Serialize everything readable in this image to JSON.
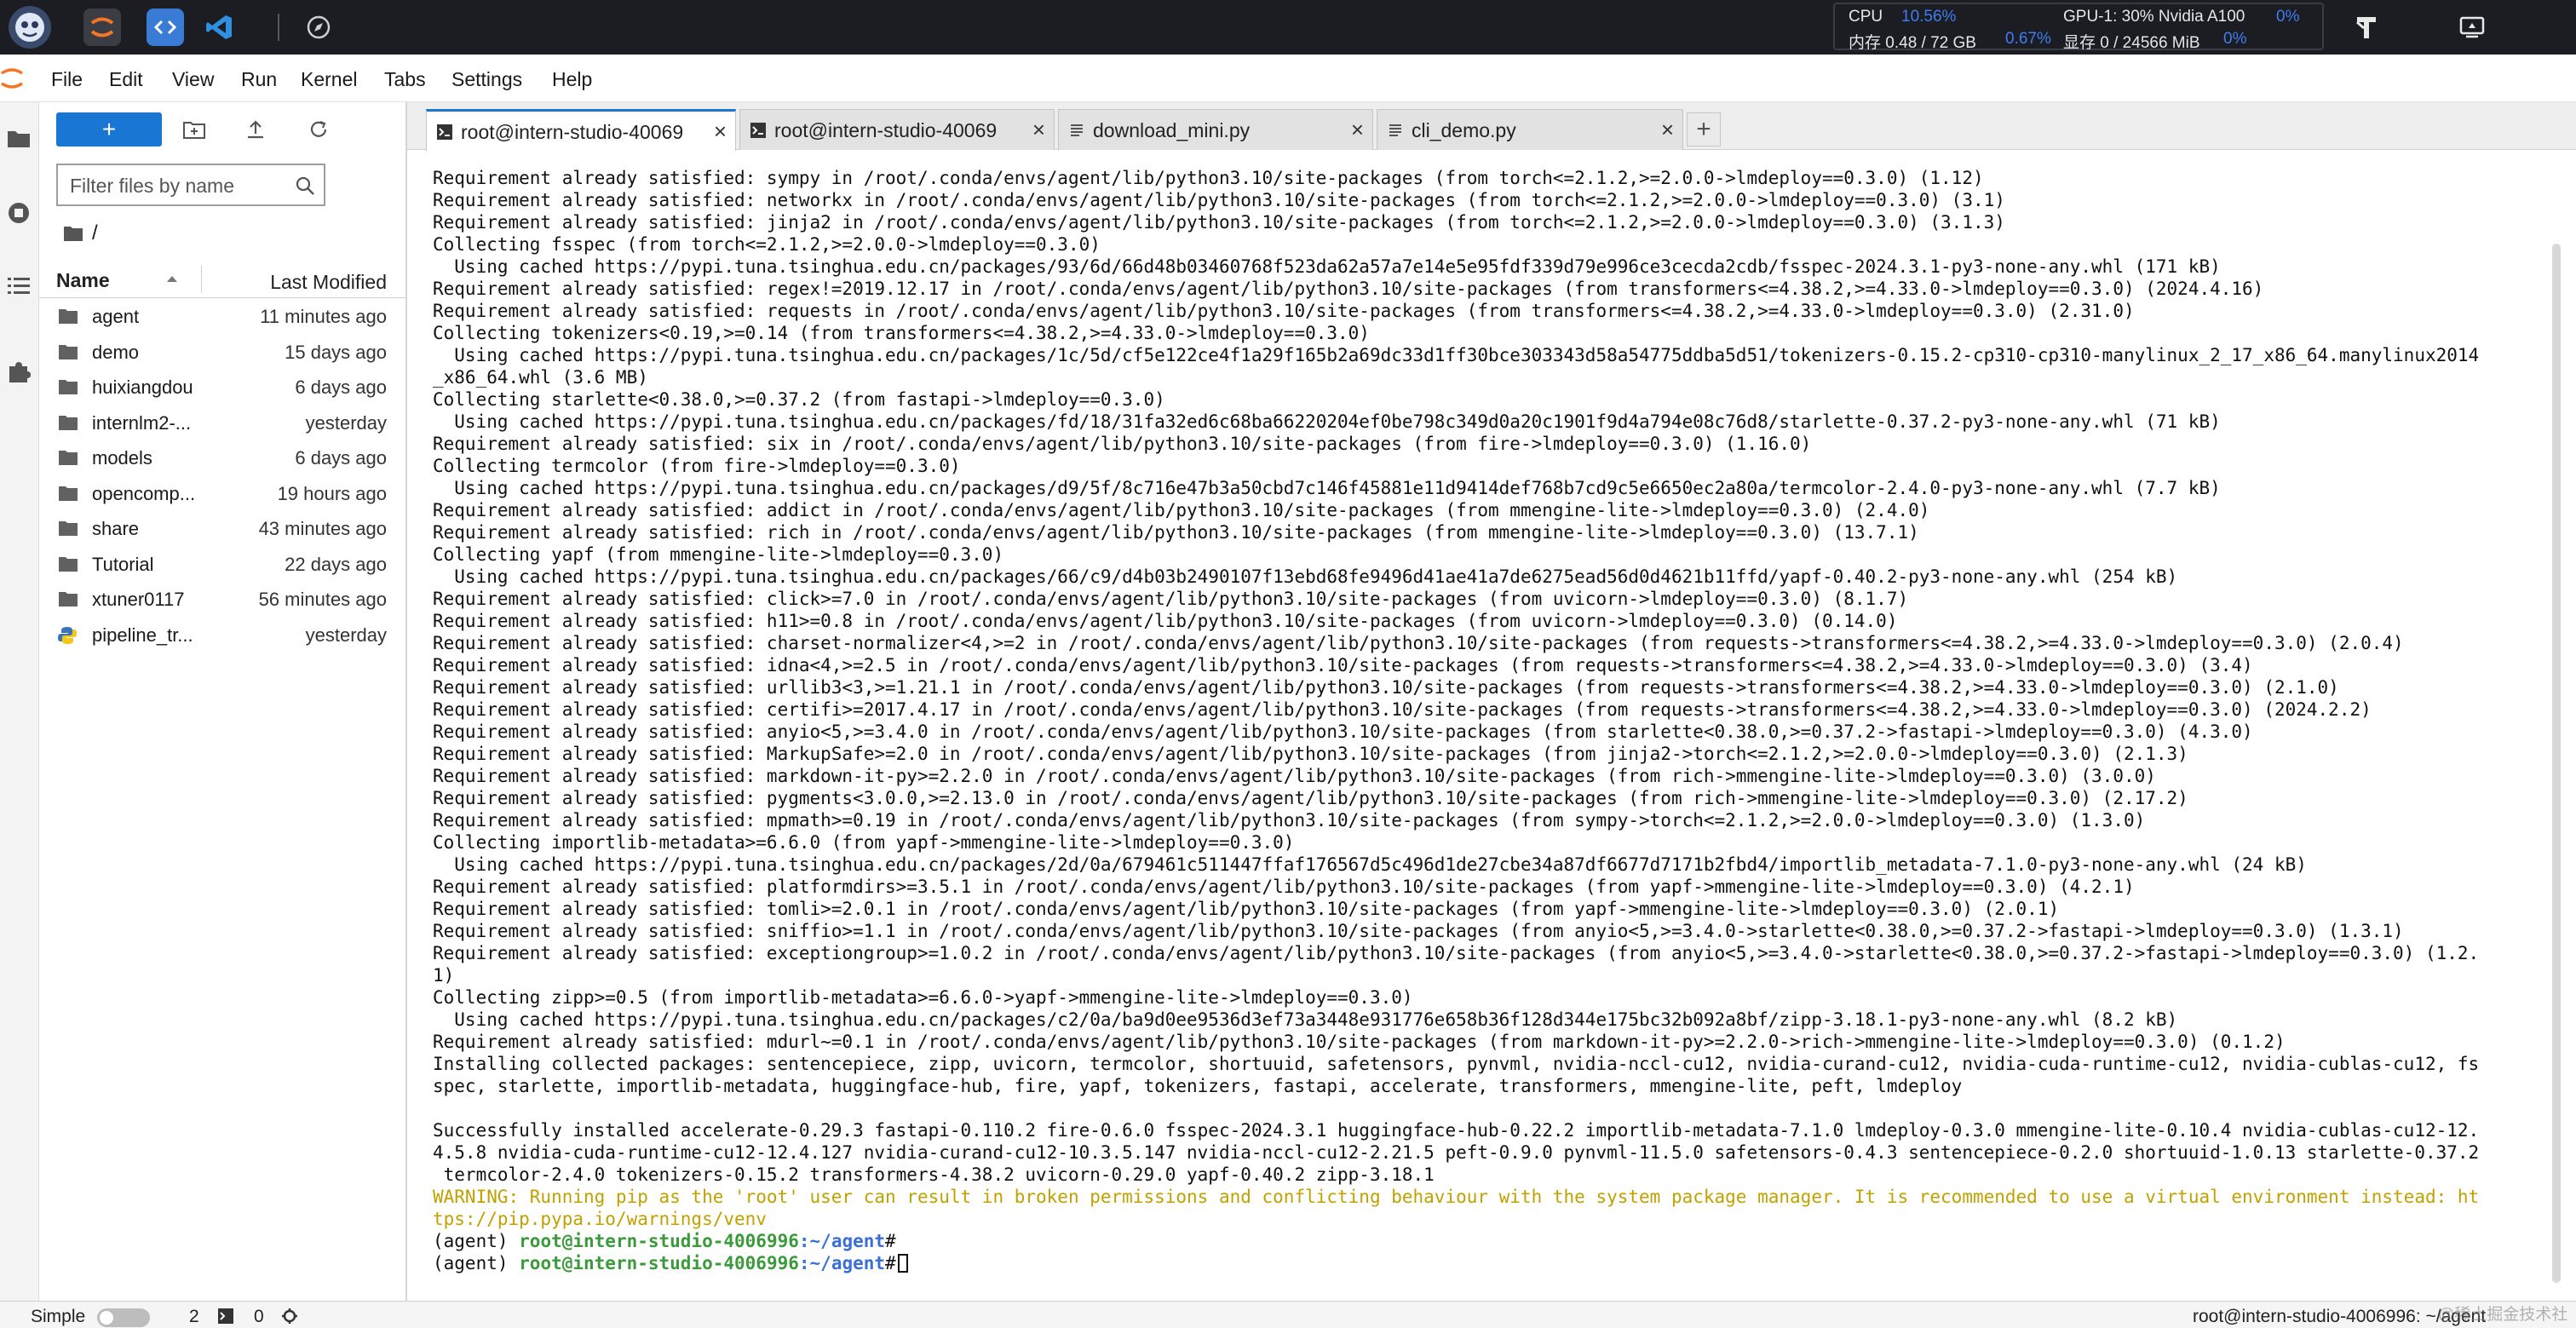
{
  "topbar": {
    "sysinfo": {
      "cpu_label": "CPU",
      "cpu_value": "10.56%",
      "gpu_label": "GPU-1: 30% Nvidia A100",
      "gpu_value": "0%",
      "mem_label": "内存 0.48 / 72 GB",
      "mem_value": "0.67%",
      "vram_label": "显存 0 / 24566 MiB",
      "vram_value": "0%"
    }
  },
  "menu": {
    "items": [
      "File",
      "Edit",
      "View",
      "Run",
      "Kernel",
      "Tabs",
      "Settings",
      "Help"
    ]
  },
  "filebrowser": {
    "new_label": "+",
    "filter_placeholder": "Filter files by name",
    "breadcrumb": "/",
    "col_name": "Name",
    "col_modified": "Last Modified",
    "files": [
      {
        "name": "agent",
        "modified": "11 minutes ago",
        "type": "folder"
      },
      {
        "name": "demo",
        "modified": "15 days ago",
        "type": "folder"
      },
      {
        "name": "huixiangdou",
        "modified": "6 days ago",
        "type": "folder"
      },
      {
        "name": "internlm2-...",
        "modified": "yesterday",
        "type": "folder"
      },
      {
        "name": "models",
        "modified": "6 days ago",
        "type": "folder"
      },
      {
        "name": "opencomp...",
        "modified": "19 hours ago",
        "type": "folder"
      },
      {
        "name": "share",
        "modified": "43 minutes ago",
        "type": "folder"
      },
      {
        "name": "Tutorial",
        "modified": "22 days ago",
        "type": "folder"
      },
      {
        "name": "xtuner0117",
        "modified": "56 minutes ago",
        "type": "folder"
      },
      {
        "name": "pipeline_tr...",
        "modified": "yesterday",
        "type": "python"
      }
    ]
  },
  "tabs": [
    {
      "label": "root@intern-studio-40069",
      "kind": "terminal",
      "active": true
    },
    {
      "label": "root@intern-studio-40069",
      "kind": "terminal",
      "active": false
    },
    {
      "label": "download_mini.py",
      "kind": "file",
      "active": false
    },
    {
      "label": "cli_demo.py",
      "kind": "file",
      "active": false
    }
  ],
  "terminal": {
    "lines": [
      "Requirement already satisfied: sympy in /root/.conda/envs/agent/lib/python3.10/site-packages (from torch<=2.1.2,>=2.0.0->lmdeploy==0.3.0) (1.12)",
      "Requirement already satisfied: networkx in /root/.conda/envs/agent/lib/python3.10/site-packages (from torch<=2.1.2,>=2.0.0->lmdeploy==0.3.0) (3.1)",
      "Requirement already satisfied: jinja2 in /root/.conda/envs/agent/lib/python3.10/site-packages (from torch<=2.1.2,>=2.0.0->lmdeploy==0.3.0) (3.1.3)",
      "Collecting fsspec (from torch<=2.1.2,>=2.0.0->lmdeploy==0.3.0)",
      "  Using cached https://pypi.tuna.tsinghua.edu.cn/packages/93/6d/66d48b03460768f523da62a57a7e14e5e95fdf339d79e996ce3cecda2cdb/fsspec-2024.3.1-py3-none-any.whl (171 kB)",
      "Requirement already satisfied: regex!=2019.12.17 in /root/.conda/envs/agent/lib/python3.10/site-packages (from transformers<=4.38.2,>=4.33.0->lmdeploy==0.3.0) (2024.4.16)",
      "Requirement already satisfied: requests in /root/.conda/envs/agent/lib/python3.10/site-packages (from transformers<=4.38.2,>=4.33.0->lmdeploy==0.3.0) (2.31.0)",
      "Collecting tokenizers<0.19,>=0.14 (from transformers<=4.38.2,>=4.33.0->lmdeploy==0.3.0)",
      "  Using cached https://pypi.tuna.tsinghua.edu.cn/packages/1c/5d/cf5e122ce4f1a29f165b2a69dc33d1ff30bce303343d58a54775ddba5d51/tokenizers-0.15.2-cp310-cp310-manylinux_2_17_x86_64.manylinux2014",
      "_x86_64.whl (3.6 MB)",
      "Collecting starlette<0.38.0,>=0.37.2 (from fastapi->lmdeploy==0.3.0)",
      "  Using cached https://pypi.tuna.tsinghua.edu.cn/packages/fd/18/31fa32ed6c68ba66220204ef0be798c349d0a20c1901f9d4a794e08c76d8/starlette-0.37.2-py3-none-any.whl (71 kB)",
      "Requirement already satisfied: six in /root/.conda/envs/agent/lib/python3.10/site-packages (from fire->lmdeploy==0.3.0) (1.16.0)",
      "Collecting termcolor (from fire->lmdeploy==0.3.0)",
      "  Using cached https://pypi.tuna.tsinghua.edu.cn/packages/d9/5f/8c716e47b3a50cbd7c146f45881e11d9414def768b7cd9c5e6650ec2a80a/termcolor-2.4.0-py3-none-any.whl (7.7 kB)",
      "Requirement already satisfied: addict in /root/.conda/envs/agent/lib/python3.10/site-packages (from mmengine-lite->lmdeploy==0.3.0) (2.4.0)",
      "Requirement already satisfied: rich in /root/.conda/envs/agent/lib/python3.10/site-packages (from mmengine-lite->lmdeploy==0.3.0) (13.7.1)",
      "Collecting yapf (from mmengine-lite->lmdeploy==0.3.0)",
      "  Using cached https://pypi.tuna.tsinghua.edu.cn/packages/66/c9/d4b03b2490107f13ebd68fe9496d41ae41a7de6275ead56d0d4621b11ffd/yapf-0.40.2-py3-none-any.whl (254 kB)",
      "Requirement already satisfied: click>=7.0 in /root/.conda/envs/agent/lib/python3.10/site-packages (from uvicorn->lmdeploy==0.3.0) (8.1.7)",
      "Requirement already satisfied: h11>=0.8 in /root/.conda/envs/agent/lib/python3.10/site-packages (from uvicorn->lmdeploy==0.3.0) (0.14.0)",
      "Requirement already satisfied: charset-normalizer<4,>=2 in /root/.conda/envs/agent/lib/python3.10/site-packages (from requests->transformers<=4.38.2,>=4.33.0->lmdeploy==0.3.0) (2.0.4)",
      "Requirement already satisfied: idna<4,>=2.5 in /root/.conda/envs/agent/lib/python3.10/site-packages (from requests->transformers<=4.38.2,>=4.33.0->lmdeploy==0.3.0) (3.4)",
      "Requirement already satisfied: urllib3<3,>=1.21.1 in /root/.conda/envs/agent/lib/python3.10/site-packages (from requests->transformers<=4.38.2,>=4.33.0->lmdeploy==0.3.0) (2.1.0)",
      "Requirement already satisfied: certifi>=2017.4.17 in /root/.conda/envs/agent/lib/python3.10/site-packages (from requests->transformers<=4.38.2,>=4.33.0->lmdeploy==0.3.0) (2024.2.2)",
      "Requirement already satisfied: anyio<5,>=3.4.0 in /root/.conda/envs/agent/lib/python3.10/site-packages (from starlette<0.38.0,>=0.37.2->fastapi->lmdeploy==0.3.0) (4.3.0)",
      "Requirement already satisfied: MarkupSafe>=2.0 in /root/.conda/envs/agent/lib/python3.10/site-packages (from jinja2->torch<=2.1.2,>=2.0.0->lmdeploy==0.3.0) (2.1.3)",
      "Requirement already satisfied: markdown-it-py>=2.2.0 in /root/.conda/envs/agent/lib/python3.10/site-packages (from rich->mmengine-lite->lmdeploy==0.3.0) (3.0.0)",
      "Requirement already satisfied: pygments<3.0.0,>=2.13.0 in /root/.conda/envs/agent/lib/python3.10/site-packages (from rich->mmengine-lite->lmdeploy==0.3.0) (2.17.2)",
      "Requirement already satisfied: mpmath>=0.19 in /root/.conda/envs/agent/lib/python3.10/site-packages (from sympy->torch<=2.1.2,>=2.0.0->lmdeploy==0.3.0) (1.3.0)",
      "Collecting importlib-metadata>=6.6.0 (from yapf->mmengine-lite->lmdeploy==0.3.0)",
      "  Using cached https://pypi.tuna.tsinghua.edu.cn/packages/2d/0a/679461c511447ffaf176567d5c496d1de27cbe34a87df6677d7171b2fbd4/importlib_metadata-7.1.0-py3-none-any.whl (24 kB)",
      "Requirement already satisfied: platformdirs>=3.5.1 in /root/.conda/envs/agent/lib/python3.10/site-packages (from yapf->mmengine-lite->lmdeploy==0.3.0) (4.2.1)",
      "Requirement already satisfied: tomli>=2.0.1 in /root/.conda/envs/agent/lib/python3.10/site-packages (from yapf->mmengine-lite->lmdeploy==0.3.0) (2.0.1)",
      "Requirement already satisfied: sniffio>=1.1 in /root/.conda/envs/agent/lib/python3.10/site-packages (from anyio<5,>=3.4.0->starlette<0.38.0,>=0.37.2->fastapi->lmdeploy==0.3.0) (1.3.1)",
      "Requirement already satisfied: exceptiongroup>=1.0.2 in /root/.conda/envs/agent/lib/python3.10/site-packages (from anyio<5,>=3.4.0->starlette<0.38.0,>=0.37.2->fastapi->lmdeploy==0.3.0) (1.2.",
      "1)",
      "Collecting zipp>=0.5 (from importlib-metadata>=6.6.0->yapf->mmengine-lite->lmdeploy==0.3.0)",
      "  Using cached https://pypi.tuna.tsinghua.edu.cn/packages/c2/0a/ba9d0ee9536d3ef73a3448e931776e658b36f128d344e175bc32b092a8bf/zipp-3.18.1-py3-none-any.whl (8.2 kB)",
      "Requirement already satisfied: mdurl~=0.1 in /root/.conda/envs/agent/lib/python3.10/site-packages (from markdown-it-py>=2.2.0->rich->mmengine-lite->lmdeploy==0.3.0) (0.1.2)",
      "Installing collected packages: sentencepiece, zipp, uvicorn, termcolor, shortuuid, safetensors, pynvml, nvidia-nccl-cu12, nvidia-curand-cu12, nvidia-cuda-runtime-cu12, nvidia-cublas-cu12, fs",
      "spec, starlette, importlib-metadata, huggingface-hub, fire, yapf, tokenizers, fastapi, accelerate, transformers, mmengine-lite, peft, lmdeploy",
      "",
      "Successfully installed accelerate-0.29.3 fastapi-0.110.2 fire-0.6.0 fsspec-2024.3.1 huggingface-hub-0.22.2 importlib-metadata-7.1.0 lmdeploy-0.3.0 mmengine-lite-0.10.4 nvidia-cublas-cu12-12.",
      "4.5.8 nvidia-cuda-runtime-cu12-12.4.127 nvidia-curand-cu12-10.3.5.147 nvidia-nccl-cu12-2.21.5 peft-0.9.0 pynvml-11.5.0 safetensors-0.4.3 sentencepiece-0.2.0 shortuuid-1.0.13 starlette-0.37.2",
      " termcolor-2.4.0 tokenizers-0.15.2 transformers-4.38.2 uvicorn-0.29.0 yapf-0.40.2 zipp-3.18.1"
    ],
    "warning_lines": [
      "WARNING: Running pip as the 'root' user can result in broken permissions and conflicting behaviour with the system package manager. It is recommended to use a virtual environment instead: ht",
      "tps://pip.pypa.io/warnings/venv"
    ],
    "prompt": {
      "env": "(agent) ",
      "host": "root@intern-studio-4006996",
      "path": ":~/agent",
      "symbol": "#"
    }
  },
  "statusbar": {
    "mode": "Simple",
    "terminals": "2",
    "kernels": "0",
    "right": "root@intern-studio-4006996: ~/agent"
  },
  "watermark": "@稀土掘金技术社区",
  "colors": {
    "accent": "#1976d2",
    "prompt_host": "#3c9a3c",
    "prompt_path": "#3b6fd6",
    "warning": "#c0a100",
    "topbar": "#1c1d22"
  }
}
